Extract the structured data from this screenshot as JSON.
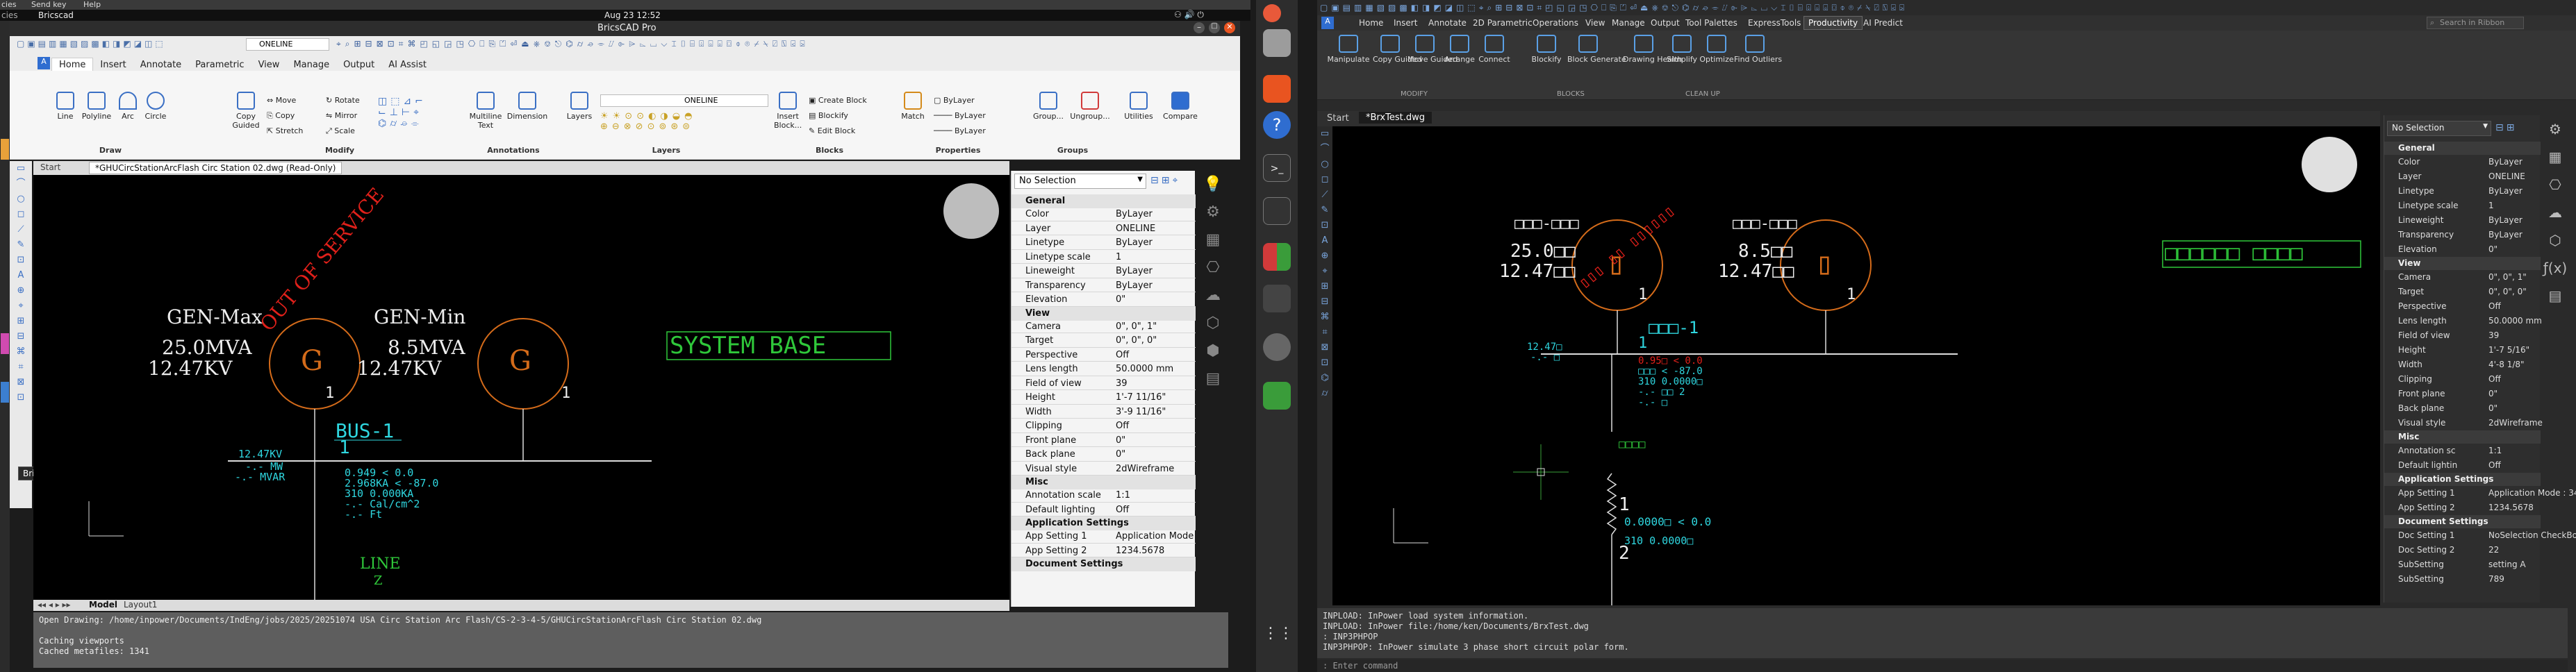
{
  "left": {
    "os_menu": [
      "cies",
      "Send key",
      "Help"
    ],
    "app_menu": "Bricscad",
    "clock": "Aug 23  12:52",
    "window_title": "BricsCAD Pro",
    "layer_field": "ONELINE",
    "ribbon_tabs": [
      "Home",
      "Insert",
      "Annotate",
      "Parametric",
      "View",
      "Manage",
      "Output",
      "AI Assist"
    ],
    "groups": [
      "Draw",
      "Modify",
      "Annotations",
      "Layers",
      "Blocks",
      "Properties",
      "Groups"
    ],
    "draw_tools": [
      "Line",
      "Polyline",
      "Arc",
      "Circle"
    ],
    "modify_tools": [
      "Move",
      "Rotate",
      "Copy",
      "Mirror",
      "Stretch",
      "Scale"
    ],
    "copy_guided": "Copy Guided",
    "annot_tools": [
      "Multiline Text",
      "Dimension"
    ],
    "layers_label": "Layers",
    "layers_field": "ONELINE",
    "block_tools": [
      "Insert Block...",
      "Create Block",
      "Blockify",
      "Edit Block"
    ],
    "match": "Match",
    "bylayer": [
      "ByLayer",
      "ByLayer",
      "ByLayer"
    ],
    "group_tools": [
      "Group...",
      "Ungroup..."
    ],
    "utilities": "Utilities",
    "compare": "Compare",
    "doc_tabs": [
      "Start",
      "*GHUCircStationArcFlash Circ Station 02.dwg (Read-Only)"
    ],
    "tooltip": "Bricscad",
    "layout_tabs": [
      "Model",
      "Layout1"
    ],
    "cmd_lines": [
      "Open Drawing: /home/inpower/Documents/IndEng/jobs/2025/20251074 USA Circ Station Arc Flash/CS-2-3-4-5/GHUCircStationArcFlash Circ Station 02.dwg",
      "",
      "Caching viewports",
      "Cached metafiles: 1341"
    ],
    "drawing": {
      "gen1_name": "GEN-Max",
      "gen1_mva": "25.0MVA",
      "gen1_kv": "12.47KV",
      "gen2_name": "GEN-Min",
      "gen2_mva": "8.5MVA",
      "gen2_kv": "12.47KV",
      "g": "G",
      "one": "1",
      "oos": "OUT OF SERVICE",
      "sysbase": "SYSTEM BASE",
      "bus": "BUS-1",
      "bus_num": "1",
      "bus_kv": "12.47KV",
      "mw": "-.- MW",
      "mvar": "-.- MVAR",
      "v1": "0.949   < 0.0",
      "v2": "2.968KA  < -87.0",
      "v3": "310 0.000KA",
      "v4": "-.- Cal/cm^2",
      "v5": "-.- Ft",
      "line": "LINE",
      "z": "Z"
    },
    "props": {
      "selection": "No Selection",
      "sections": [
        "General",
        "View",
        "Misc",
        "Application Settings",
        "Document Settings"
      ],
      "general": [
        [
          "Color",
          "ByLayer"
        ],
        [
          "Layer",
          "ONELINE"
        ],
        [
          "Linetype",
          "ByLayer"
        ],
        [
          "Linetype scale",
          "1"
        ],
        [
          "Lineweight",
          "ByLayer"
        ],
        [
          "Transparency",
          "ByLayer"
        ],
        [
          "Elevation",
          "0\""
        ]
      ],
      "view": [
        [
          "Camera",
          "0\", 0\", 1\""
        ],
        [
          "Target",
          "0\", 0\", 0\""
        ],
        [
          "Perspective",
          "Off"
        ],
        [
          "Lens length",
          "50.0000 mm"
        ],
        [
          "Field of view",
          "39"
        ],
        [
          "Height",
          "1'-7 11/16\""
        ],
        [
          "Width",
          "3'-9 11/16\""
        ],
        [
          "Clipping",
          "Off"
        ],
        [
          "Front plane",
          "0\""
        ],
        [
          "Back plane",
          "0\""
        ],
        [
          "Visual style",
          "2dWireframe"
        ]
      ],
      "misc": [
        [
          "Annotation scale",
          "1:1"
        ],
        [
          "Default lighting",
          "Off"
        ]
      ],
      "app": [
        [
          "App Setting 1",
          "Application Mode"
        ],
        [
          "App Setting 2",
          "1234.5678"
        ]
      ]
    }
  },
  "right": {
    "ribbon_tabs": [
      "Home",
      "Insert",
      "Annotate",
      "2D Parametric",
      "Operations",
      "View",
      "Manage",
      "Output",
      "Tool Palettes",
      "ExpressTools",
      "Productivity",
      "AI Predict"
    ],
    "active_tab": "Productivity",
    "search": "Search in Ribbon",
    "modify_tools": [
      "Manipulate",
      "Copy Guided",
      "Move Guided",
      "Arrange",
      "Connect"
    ],
    "block_tools": [
      "Blockify",
      "Block Generate"
    ],
    "clean_tools": [
      "Drawing Health",
      "Simplify",
      "Optimize",
      "Find Outliers"
    ],
    "group_labels": [
      "MODIFY",
      "BLOCKS",
      "CLEAN UP"
    ],
    "doc_tabs": [
      "Start",
      "*BrxTest.dwg"
    ],
    "cmd_lines": [
      "INPLOAD: InPower load system information.",
      "INPLOAD: InPower file:/home/ken/Documents/BrxTest.dwg",
      ": INP3PHPOP",
      "INP3PHPOP: InPower simulate 3 phase short circuit polar form."
    ],
    "cmd_prompt": ": Enter command",
    "drawing": {
      "gen1_name": "□□□-□□□",
      "gen1_mva": "25.0□□",
      "gen1_kv": "12.47□□",
      "gen2_name": "□□□-□□□",
      "gen2_mva": "8.5□□",
      "gen2_kv": "12.47□□",
      "box": "▯",
      "one": "1",
      "sysbase": "□□□□□□  □□□□",
      "bus": "□□□-1",
      "bus_num": "1",
      "bus_kv": "12.47□",
      "mw": "-.- □",
      "v1": "0.95□   < 0.0",
      "v2": "□□□ < -87.0",
      "v3": "310 0.0000□",
      "v4": "-.- □□ 2",
      "v5": "-.- □",
      "line": "□□□□",
      "low1": "1",
      "low2": "0.0000□  < 0.0",
      "low3": "310 0.0000□",
      "low4": "2"
    },
    "props": {
      "selection": "No Selection",
      "general": [
        [
          "Color",
          "ByLayer"
        ],
        [
          "Layer",
          "ONELINE"
        ],
        [
          "Linetype",
          "ByLayer"
        ],
        [
          "Linetype scale",
          "1"
        ],
        [
          "Lineweight",
          "ByLayer"
        ],
        [
          "Transparency",
          "ByLayer"
        ],
        [
          "Elevation",
          "0\""
        ]
      ],
      "view": [
        [
          "Camera",
          "0\", 0\", 1\""
        ],
        [
          "Target",
          "0\", 0\", 0\""
        ],
        [
          "Perspective",
          "Off"
        ],
        [
          "Lens length",
          "50.0000 mm"
        ],
        [
          "Field of view",
          "39"
        ],
        [
          "Height",
          "1'-7 5/16\""
        ],
        [
          "Width",
          "4'-8 1/8\""
        ],
        [
          "Clipping",
          "Off"
        ],
        [
          "Front plane",
          "0\""
        ],
        [
          "Back plane",
          "0\""
        ],
        [
          "Visual style",
          "2dWireframe"
        ]
      ],
      "misc": [
        [
          "Annotation sc",
          "1:1"
        ],
        [
          "Default lightin",
          "Off"
        ]
      ],
      "app": [
        [
          "App Setting 1",
          "Application Mode : 34"
        ],
        [
          "App Setting 2",
          "1234.5678"
        ]
      ],
      "doc": [
        [
          "Doc Setting 1",
          "NoSelection CheckBox v"
        ],
        [
          "Doc Setting 2",
          "22"
        ],
        [
          "SubSetting",
          "setting A"
        ],
        [
          "SubSetting",
          "789"
        ]
      ],
      "sections": [
        "General",
        "View",
        "Misc",
        "Application Settings",
        "Document Settings"
      ]
    }
  }
}
